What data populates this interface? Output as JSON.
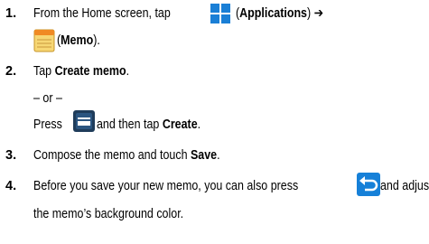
{
  "steps": [
    {
      "number": "1.",
      "text_a": "From the Home screen, tap ",
      "text_b": " (",
      "bold_a": "Applications",
      "text_c": ") ➔",
      "text_d": " (",
      "bold_b": "Memo",
      "text_e": ")."
    },
    {
      "number": "2.",
      "text_a": "Tap ",
      "bold_a": "Create memo",
      "text_b": ".",
      "or_line": "– or –",
      "press": "Press ",
      "then": " and then tap ",
      "bold_b": "Create",
      "end": "."
    },
    {
      "number": "3.",
      "text_a": "Compose the memo and touch ",
      "bold_a": "Save",
      "text_b": "."
    },
    {
      "number": "4.",
      "line1": "Before you save your new memo, you can also press ",
      "line1_end": " and adjust",
      "line2": "the memo’s background color."
    }
  ],
  "icons": {
    "applications": "applications-grid-icon",
    "memo": "memo-notepad-icon",
    "menu": "menu-icon",
    "back": "back-arrow-icon"
  },
  "colors": {
    "icon_blue": "#1a7fd6",
    "memo_yellow": "#f7d774",
    "memo_orange": "#f08a24",
    "menu_dark": "#1f3c5a",
    "back_blue": "#1680d8"
  }
}
